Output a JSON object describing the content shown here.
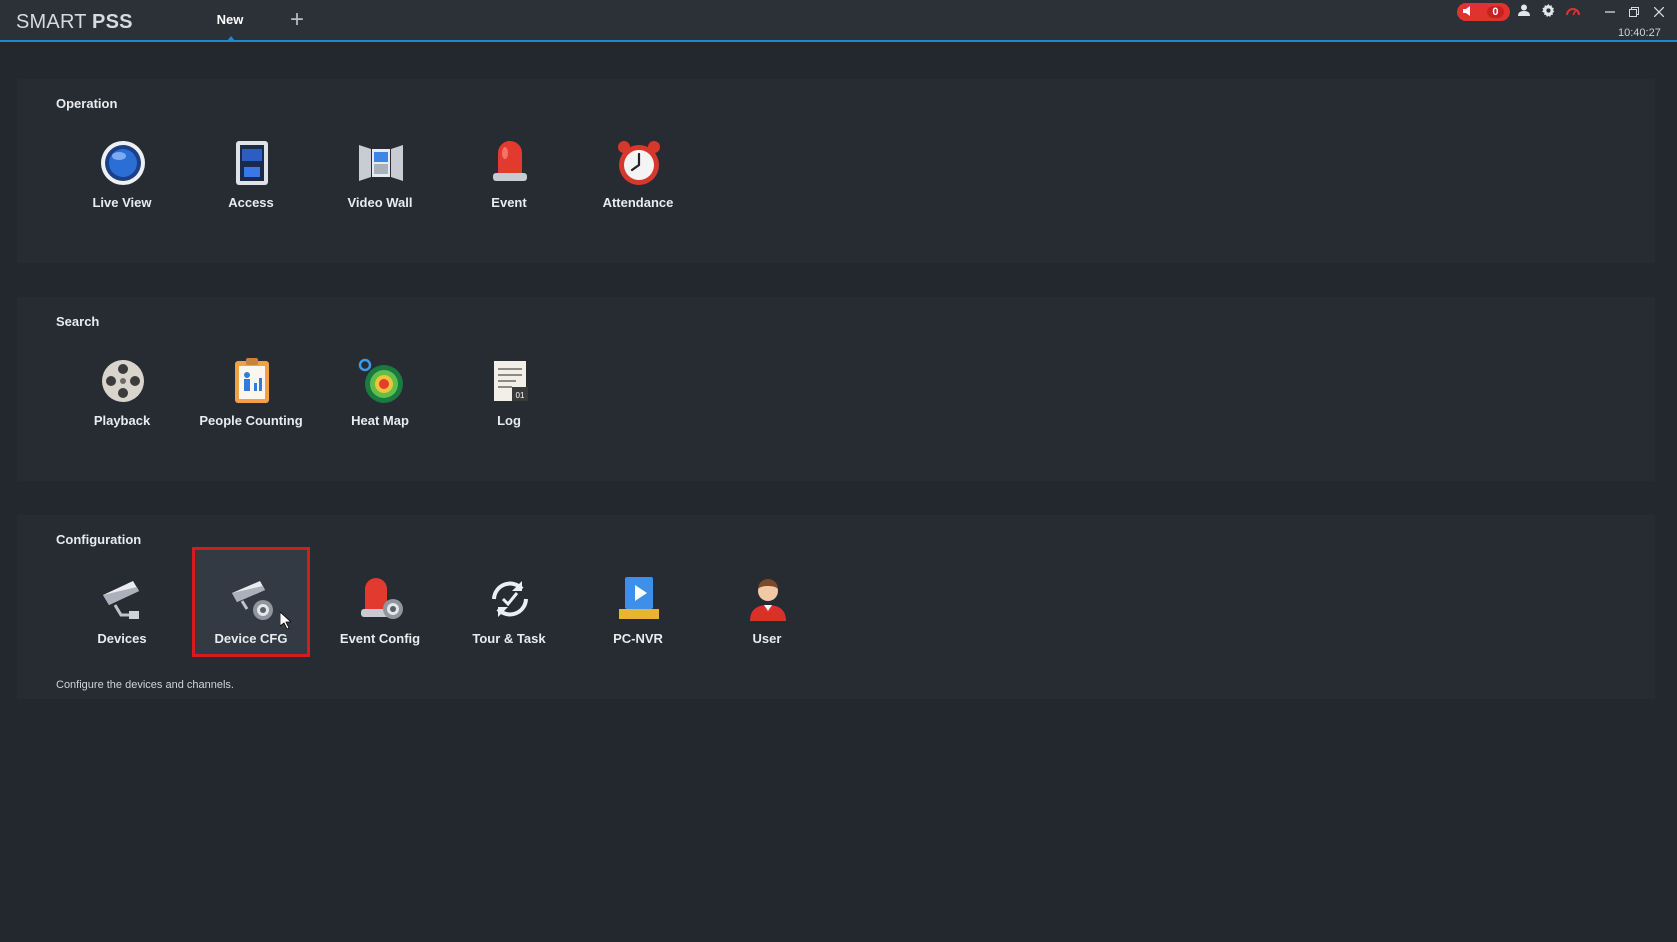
{
  "titlebar": {
    "app_name_light": "SMART",
    "app_name_bold": "PSS",
    "tab_label": "New",
    "add_tab_symbol": "+",
    "alarm_count": "0",
    "time": "10:40:27",
    "icons": [
      "speaker-icon",
      "user-icon",
      "gear-icon",
      "gauge-icon",
      "minimize-icon",
      "restore-icon",
      "close-icon"
    ]
  },
  "sections": {
    "operation": {
      "title": "Operation",
      "apps": [
        {
          "label": "Live View",
          "icon": "live-view-icon"
        },
        {
          "label": "Access",
          "icon": "access-icon"
        },
        {
          "label": "Video Wall",
          "icon": "video-wall-icon"
        },
        {
          "label": "Event",
          "icon": "event-siren-icon"
        },
        {
          "label": "Attendance",
          "icon": "alarm-clock-icon"
        }
      ]
    },
    "search": {
      "title": "Search",
      "apps": [
        {
          "label": "Playback",
          "icon": "film-reel-icon"
        },
        {
          "label": "People Counting",
          "icon": "people-counting-icon"
        },
        {
          "label": "Heat Map",
          "icon": "heat-map-icon"
        },
        {
          "label": "Log",
          "icon": "log-icon"
        }
      ]
    },
    "configuration": {
      "title": "Configuration",
      "apps": [
        {
          "label": "Devices",
          "icon": "camera-icon"
        },
        {
          "label": "Device CFG",
          "icon": "camera-gear-icon",
          "selected": true
        },
        {
          "label": "Event Config",
          "icon": "siren-gear-icon"
        },
        {
          "label": "Tour & Task",
          "icon": "tour-task-icon"
        },
        {
          "label": "PC-NVR",
          "icon": "pc-nvr-icon"
        },
        {
          "label": "User",
          "icon": "user-avatar-icon"
        }
      ],
      "description": "Configure the devices and channels."
    }
  },
  "colors": {
    "background": "#23272e",
    "panel": "#272b32",
    "accent": "#1e88d8",
    "selection_border": "#d61b1b",
    "alarm": "#e0332f"
  }
}
